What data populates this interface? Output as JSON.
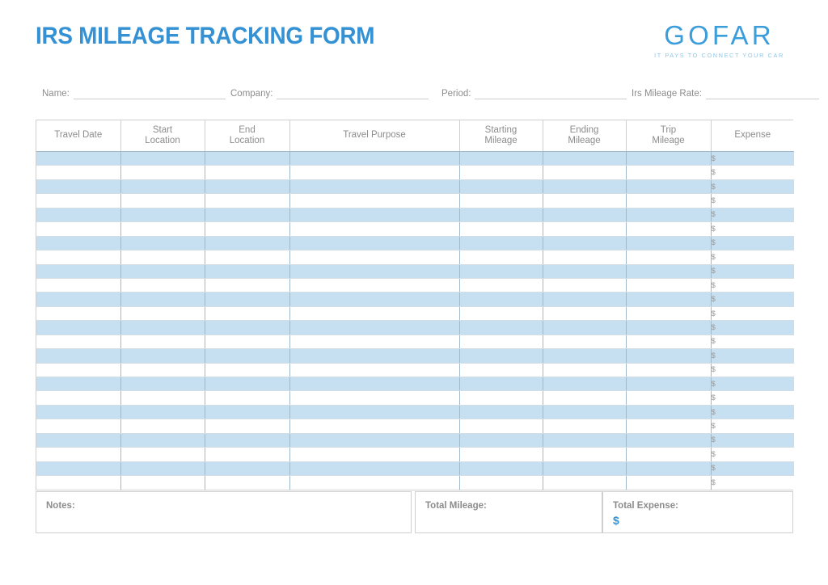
{
  "document": {
    "title": "IRS MILEAGE TRACKING FORM",
    "accent_color": "#3391d4",
    "band_color": "#c6e0f1",
    "label_color": "#8c8c8c"
  },
  "brand": {
    "name": "GOFAR",
    "tagline": "IT PAYS TO CONNECT YOUR CAR"
  },
  "info_fields": [
    {
      "label": "Name:",
      "value": ""
    },
    {
      "label": "Company:",
      "value": ""
    },
    {
      "label": "Period:",
      "value": ""
    },
    {
      "label": "Irs Mileage Rate:",
      "value": ""
    }
  ],
  "table": {
    "columns": [
      {
        "key": "travel_date",
        "label": "Travel Date"
      },
      {
        "key": "start_location",
        "label": "Start\nLocation",
        "line1": "Start",
        "line2": "Location"
      },
      {
        "key": "end_location",
        "label": "End\nLocation",
        "line1": "End",
        "line2": "Location"
      },
      {
        "key": "travel_purpose",
        "label": "Travel Purpose"
      },
      {
        "key": "starting_mileage",
        "label": "Starting\nMileage",
        "line1": "Starting",
        "line2": "Mileage"
      },
      {
        "key": "ending_mileage",
        "label": "Ending\nMileage",
        "line1": "Ending",
        "line2": "Mileage"
      },
      {
        "key": "trip_mileage",
        "label": "Trip\nMileage",
        "line1": "Trip",
        "line2": "Mileage"
      },
      {
        "key": "expense",
        "label": "Expense"
      }
    ],
    "row_count": 24,
    "currency_symbol": "$",
    "rows": [
      {
        "travel_date": "",
        "start_location": "",
        "end_location": "",
        "travel_purpose": "",
        "starting_mileage": "",
        "ending_mileage": "",
        "trip_mileage": "",
        "expense": "$"
      },
      {
        "travel_date": "",
        "start_location": "",
        "end_location": "",
        "travel_purpose": "",
        "starting_mileage": "",
        "ending_mileage": "",
        "trip_mileage": "",
        "expense": "$"
      },
      {
        "travel_date": "",
        "start_location": "",
        "end_location": "",
        "travel_purpose": "",
        "starting_mileage": "",
        "ending_mileage": "",
        "trip_mileage": "",
        "expense": "$"
      },
      {
        "travel_date": "",
        "start_location": "",
        "end_location": "",
        "travel_purpose": "",
        "starting_mileage": "",
        "ending_mileage": "",
        "trip_mileage": "",
        "expense": "$"
      },
      {
        "travel_date": "",
        "start_location": "",
        "end_location": "",
        "travel_purpose": "",
        "starting_mileage": "",
        "ending_mileage": "",
        "trip_mileage": "",
        "expense": "$"
      },
      {
        "travel_date": "",
        "start_location": "",
        "end_location": "",
        "travel_purpose": "",
        "starting_mileage": "",
        "ending_mileage": "",
        "trip_mileage": "",
        "expense": "$"
      },
      {
        "travel_date": "",
        "start_location": "",
        "end_location": "",
        "travel_purpose": "",
        "starting_mileage": "",
        "ending_mileage": "",
        "trip_mileage": "",
        "expense": "$"
      },
      {
        "travel_date": "",
        "start_location": "",
        "end_location": "",
        "travel_purpose": "",
        "starting_mileage": "",
        "ending_mileage": "",
        "trip_mileage": "",
        "expense": "$"
      },
      {
        "travel_date": "",
        "start_location": "",
        "end_location": "",
        "travel_purpose": "",
        "starting_mileage": "",
        "ending_mileage": "",
        "trip_mileage": "",
        "expense": "$"
      },
      {
        "travel_date": "",
        "start_location": "",
        "end_location": "",
        "travel_purpose": "",
        "starting_mileage": "",
        "ending_mileage": "",
        "trip_mileage": "",
        "expense": "$"
      },
      {
        "travel_date": "",
        "start_location": "",
        "end_location": "",
        "travel_purpose": "",
        "starting_mileage": "",
        "ending_mileage": "",
        "trip_mileage": "",
        "expense": "$"
      },
      {
        "travel_date": "",
        "start_location": "",
        "end_location": "",
        "travel_purpose": "",
        "starting_mileage": "",
        "ending_mileage": "",
        "trip_mileage": "",
        "expense": "$"
      },
      {
        "travel_date": "",
        "start_location": "",
        "end_location": "",
        "travel_purpose": "",
        "starting_mileage": "",
        "ending_mileage": "",
        "trip_mileage": "",
        "expense": "$"
      },
      {
        "travel_date": "",
        "start_location": "",
        "end_location": "",
        "travel_purpose": "",
        "starting_mileage": "",
        "ending_mileage": "",
        "trip_mileage": "",
        "expense": "$"
      },
      {
        "travel_date": "",
        "start_location": "",
        "end_location": "",
        "travel_purpose": "",
        "starting_mileage": "",
        "ending_mileage": "",
        "trip_mileage": "",
        "expense": "$"
      },
      {
        "travel_date": "",
        "start_location": "",
        "end_location": "",
        "travel_purpose": "",
        "starting_mileage": "",
        "ending_mileage": "",
        "trip_mileage": "",
        "expense": "$"
      },
      {
        "travel_date": "",
        "start_location": "",
        "end_location": "",
        "travel_purpose": "",
        "starting_mileage": "",
        "ending_mileage": "",
        "trip_mileage": "",
        "expense": "$"
      },
      {
        "travel_date": "",
        "start_location": "",
        "end_location": "",
        "travel_purpose": "",
        "starting_mileage": "",
        "ending_mileage": "",
        "trip_mileage": "",
        "expense": "$"
      },
      {
        "travel_date": "",
        "start_location": "",
        "end_location": "",
        "travel_purpose": "",
        "starting_mileage": "",
        "ending_mileage": "",
        "trip_mileage": "",
        "expense": "$"
      },
      {
        "travel_date": "",
        "start_location": "",
        "end_location": "",
        "travel_purpose": "",
        "starting_mileage": "",
        "ending_mileage": "",
        "trip_mileage": "",
        "expense": "$"
      },
      {
        "travel_date": "",
        "start_location": "",
        "end_location": "",
        "travel_purpose": "",
        "starting_mileage": "",
        "ending_mileage": "",
        "trip_mileage": "",
        "expense": "$"
      },
      {
        "travel_date": "",
        "start_location": "",
        "end_location": "",
        "travel_purpose": "",
        "starting_mileage": "",
        "ending_mileage": "",
        "trip_mileage": "",
        "expense": "$"
      },
      {
        "travel_date": "",
        "start_location": "",
        "end_location": "",
        "travel_purpose": "",
        "starting_mileage": "",
        "ending_mileage": "",
        "trip_mileage": "",
        "expense": "$"
      },
      {
        "travel_date": "",
        "start_location": "",
        "end_location": "",
        "travel_purpose": "",
        "starting_mileage": "",
        "ending_mileage": "",
        "trip_mileage": "",
        "expense": "$"
      }
    ]
  },
  "footer": {
    "notes": {
      "label": "Notes:",
      "value": ""
    },
    "total_mileage": {
      "label": "Total Mileage:",
      "value": ""
    },
    "total_expense": {
      "label": "Total Expense:",
      "value": "$"
    }
  }
}
